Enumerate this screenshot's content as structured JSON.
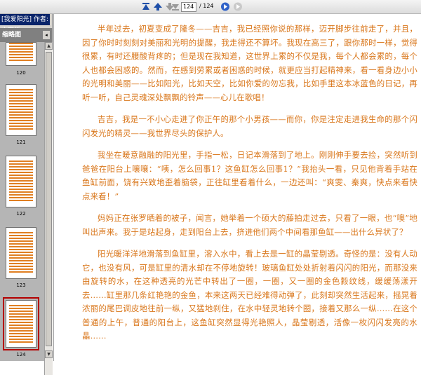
{
  "toolbar": {
    "buttons": [
      {
        "name": "first-page-icon",
        "color": "#1f4fa8"
      },
      {
        "name": "prev-page-icon",
        "color": "#1f4fa8"
      },
      {
        "name": "next-page-icon",
        "color": "#9a9a9a"
      },
      {
        "name": "last-page-icon",
        "color": "#9a9a9a"
      }
    ],
    "current_page": "124",
    "total_pages": "/ 124"
  },
  "sidebar": {
    "window_title": "[我爱阳光] 作者: 文字版",
    "panel_title": "缩略图",
    "collapse_label": "◂",
    "thumbnails": [
      {
        "label": "120"
      },
      {
        "label": "121"
      },
      {
        "label": "122"
      },
      {
        "label": "123"
      },
      {
        "label": "124",
        "selected": true
      }
    ]
  },
  "document": {
    "paragraphs": [
      "半年过去，初夏变成了隆冬——吉吉，我已经照你说的那样，迈开脚步往前走了，并且，因了你时时刻刻对美丽和光明的提醒，我走得还不算坏。我现在高三了，跟你那时一样，觉得很累，有时还腰酸背疼的；但是现在我知道，这世界上累的不仅是我，每个人都会累的，每个人也都会困惑的。然而，在感到劳累或者困惑的时候，就更应当打起精神来，看一看身边小小的光明和美丽——比如阳光，比如天空，比如你爱的勿忘我，比如手里这本冰蓝色的日记，再听一听，自己灵魂深处飘飘的铃声——心儿在歌唱！",
      "吉吉，我是一不小心走进了你正午的那个小男孩——而你，你是注定走进我生命的那个闪闪发光的精灵——我世界尽头的保护人。",
      "我坐在暖意融融的阳光里，手指一松，日记本滑落到了地上。刚刚伸手要去捡，突然听到爸爸在阳台上嚷嚷：“咦，怎么回事1？这鱼缸怎么回事1？”我抬头一看，只见他背着手站在鱼缸前面，饶有兴致地歪着脑袋，正往缸里看着什么，一边还叫：“爽雯、秦爽，快点来看快点来看！”",
      "妈妈正在张罗晒着的被子，闻言，她举着一个硕大的藤拍走过去，只看了一眼，也“噢”地叫出声来。我于是站起身，走到阳台上去，挤进他们两个中间看那鱼缸——出什么异状了？",
      "阳光暖洋洋地滑落到鱼缸里，溶入水中，看上去是一缸的晶莹剔透。奇怪的是：没有人动它，也没有风，可是缸里的清水却在不停地旋转！玻璃鱼缸处处折射着闪闪的阳光，而那没来由旋转的水，在这种透亮的光芒中转出了一圈，一圈，又一圈的金色縠纹线，缓缓荡漾开去……缸里那几条红艳艳的金鱼，本来这两天已经难得动弹了，此刻却突然生活起来，摇晃着浓丽的尾巴调皮地往前一纵，又猛地刹住，在水中轻灵地转个圈，接着又那么一纵……在这个普通的上午，普通的阳台上，这鱼缸突然显得光艳照人，晶莹剔透，活像一枚闪闪发亮的水晶……"
    ]
  }
}
